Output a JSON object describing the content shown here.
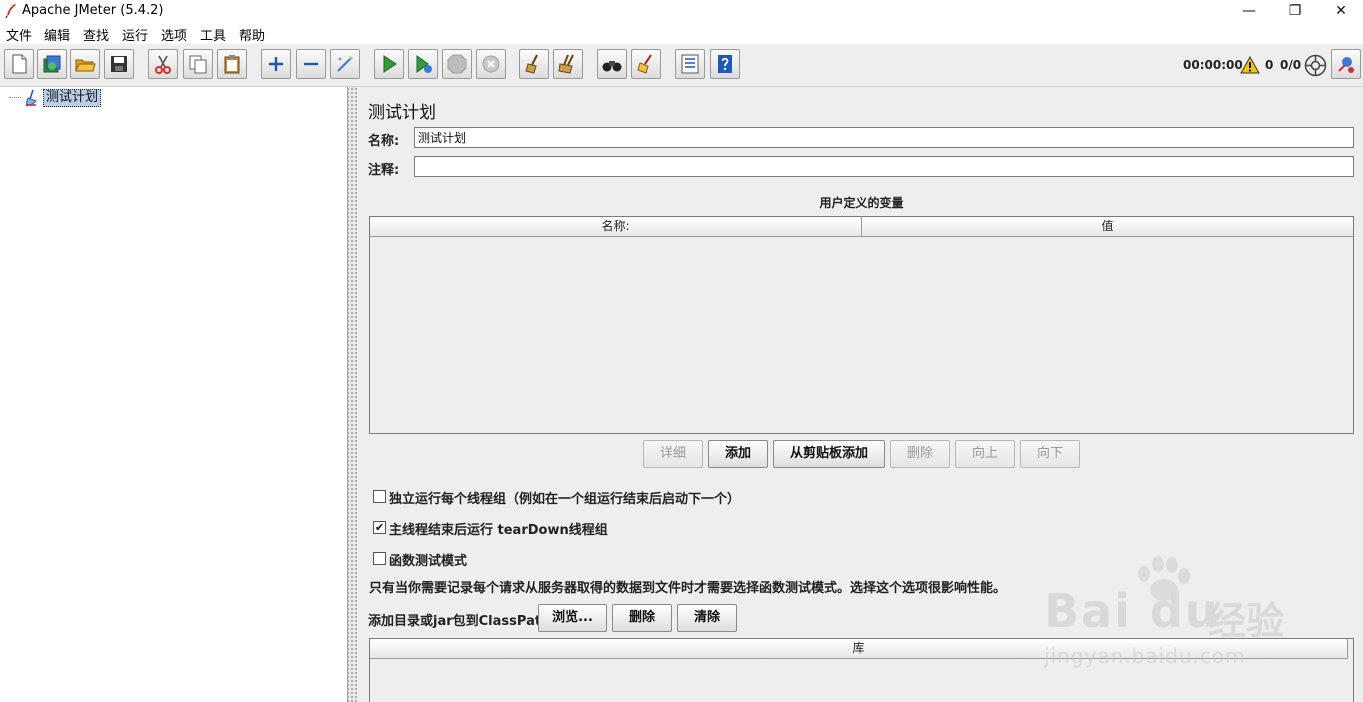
{
  "window": {
    "title": "Apache JMeter (5.4.2)",
    "minimize": "—",
    "restore": "❐",
    "close": "✕"
  },
  "menu": [
    "文件",
    "编辑",
    "查找",
    "运行",
    "选项",
    "工具",
    "帮助"
  ],
  "toolbar_status": {
    "elapsed": "00:00:00",
    "warnings": "0",
    "threads": "0/0"
  },
  "tree": {
    "root_label": "测试计划"
  },
  "test_plan": {
    "panel_title": "测试计划",
    "name_label": "名称:",
    "name_value": "测试计划",
    "comment_label": "注释:",
    "comment_value": "",
    "variables_title": "用户定义的变量",
    "variables_columns": [
      "名称:",
      "值"
    ],
    "buttons": {
      "detail": "详细",
      "add": "添加",
      "add_from_clipboard": "从剪贴板添加",
      "delete": "删除",
      "up": "向上",
      "down": "向下"
    },
    "options": [
      {
        "label": "独立运行每个线程组（例如在一个组运行结束后启动下一个）",
        "checked": false
      },
      {
        "label": "主线程结束后运行 tearDown线程组",
        "checked": true
      },
      {
        "label": "函数测试模式",
        "checked": false
      }
    ],
    "checked_mark": "✔",
    "functional_note": "只有当你需要记录每个请求从服务器取得的数据到文件时才需要选择函数测试模式。选择这个选项很影响性能。",
    "classpath_label": "添加目录或jar包到ClassPath",
    "classpath_buttons": {
      "browse": "浏览...",
      "delete": "删除",
      "clear": "清除"
    },
    "library_column": "库"
  },
  "watermark": {
    "logo": "Bai  du",
    "brand": "经验",
    "url": "jingyan.baidu.com"
  }
}
